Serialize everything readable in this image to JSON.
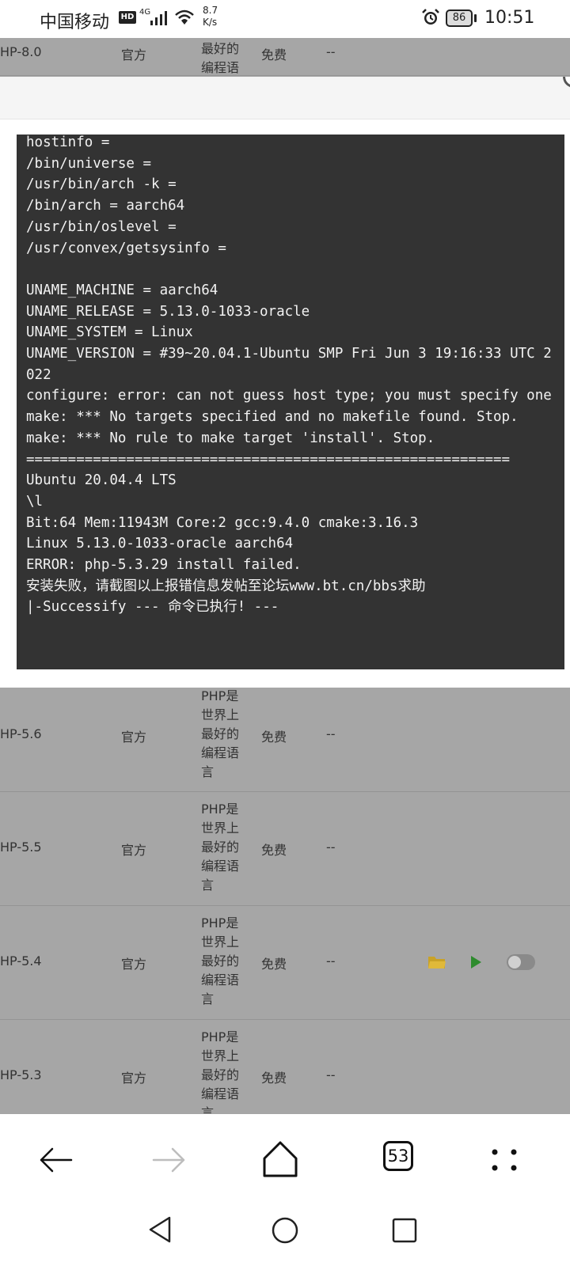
{
  "status_bar": {
    "carrier": "中国移动",
    "hd": "HD",
    "network": "4G",
    "speed_value": "8.7",
    "speed_unit": "K/s",
    "battery": "86",
    "time": "10:51",
    "icons": [
      "signal-icon",
      "wifi-icon",
      "alarm-icon",
      "battery-icon"
    ]
  },
  "software_table": {
    "rows": [
      {
        "name": "HP-8.0",
        "developer": "官方",
        "description": "PHP是世界上最好的编程语言",
        "price": "免费",
        "expire": "--"
      },
      {
        "name": "HP-5.6",
        "developer": "官方",
        "description": "PHP是世界上最好的编程语言",
        "price": "免费",
        "expire": "--"
      },
      {
        "name": "HP-5.5",
        "developer": "官方",
        "description": "PHP是世界上最好的编程语言",
        "price": "免费",
        "expire": "--"
      },
      {
        "name": "HP-5.4",
        "developer": "官方",
        "description": "PHP是世界上最好的编程语言",
        "price": "免费",
        "expire": "--",
        "installed": true
      },
      {
        "name": "HP-5.3",
        "developer": "官方",
        "description": "PHP是世界上最好的编程语言",
        "price": "免费",
        "expire": "--"
      }
    ]
  },
  "terminal": {
    "lines": [
      "hostinfo =",
      "/bin/universe =",
      "/usr/bin/arch -k =",
      "/bin/arch = aarch64",
      "/usr/bin/oslevel =",
      "/usr/convex/getsysinfo =",
      "",
      "UNAME_MACHINE = aarch64",
      "UNAME_RELEASE = 5.13.0-1033-oracle",
      "UNAME_SYSTEM = Linux",
      "UNAME_VERSION = #39~20.04.1-Ubuntu SMP Fri Jun 3 19:16:33 UTC 2022",
      "configure: error: can not guess host type; you must specify one",
      "make: *** No targets specified and no makefile found. Stop.",
      "make: *** No rule to make target 'install'. Stop.",
      "==========================================================",
      "Ubuntu 20.04.4 LTS",
      "\\l",
      "Bit:64 Mem:11943M Core:2 gcc:9.4.0 cmake:3.16.3",
      "Linux 5.13.0-1033-oracle aarch64",
      "ERROR: php-5.3.29 install failed.",
      "安装失败，请截图以上报错信息发帖至论坛www.bt.cn/bbs求助",
      "|-Successify --- 命令已执行! ---"
    ]
  },
  "browser_toolbar": {
    "tab_count": "53",
    "icons": [
      "back-arrow-icon",
      "forward-arrow-icon",
      "home-icon",
      "tabs-icon",
      "menu-dots-icon"
    ]
  },
  "system_nav": {
    "icons": [
      "nav-back-icon",
      "nav-home-icon",
      "nav-recents-icon"
    ]
  }
}
